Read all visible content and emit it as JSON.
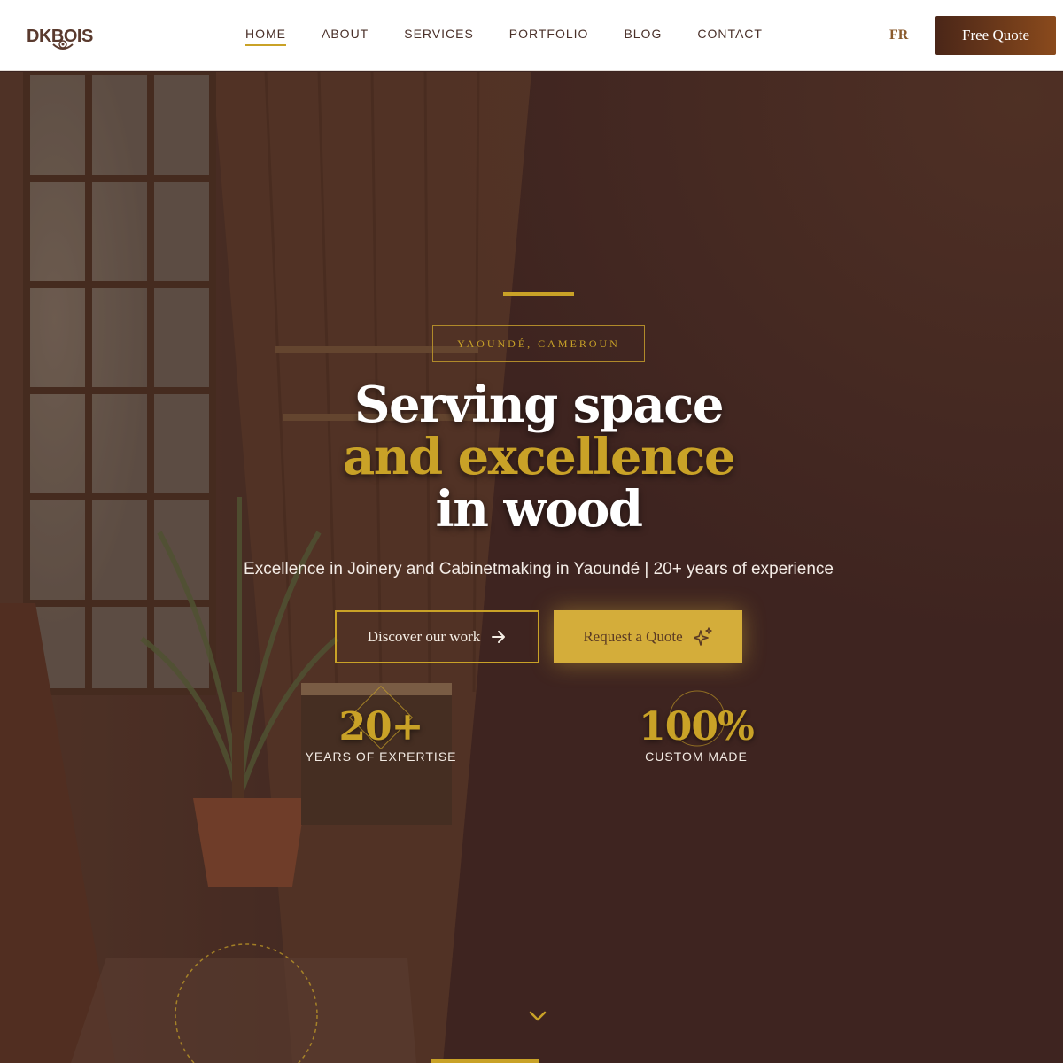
{
  "brand": {
    "logo_text": "DKBOIS"
  },
  "nav": {
    "items": [
      {
        "label": "HOME",
        "active": true
      },
      {
        "label": "ABOUT"
      },
      {
        "label": "SERVICES"
      },
      {
        "label": "PORTFOLIO"
      },
      {
        "label": "BLOG"
      },
      {
        "label": "CONTACT"
      }
    ]
  },
  "header": {
    "language": "FR",
    "cta_label": "Free Quote"
  },
  "hero": {
    "location": "YAOUNDÉ, CAMEROUN",
    "headline": {
      "line1": "Serving space",
      "line2": "and excellence",
      "line3": "in wood"
    },
    "subtitle": "Excellence in Joinery and Cabinetmaking in Yaoundé | 20+ years of experience",
    "primary_button": {
      "label": "Discover our work",
      "icon": "arrow-right-icon"
    },
    "secondary_button": {
      "label": "Request a Quote",
      "icon": "sparkles-icon"
    },
    "stats": [
      {
        "value": "20+",
        "label": "YEARS OF EXPERTISE"
      },
      {
        "value": "100%",
        "label": "CUSTOM MADE"
      }
    ],
    "scroll_icon": "chevron-down-icon"
  },
  "colors": {
    "accent_gold": "#c9a227",
    "button_gold": "#d4ad3a",
    "hero_overlay": "#3c2420",
    "cta_gradient_start": "#4a2618",
    "cta_gradient_end": "#8a4a1c"
  }
}
